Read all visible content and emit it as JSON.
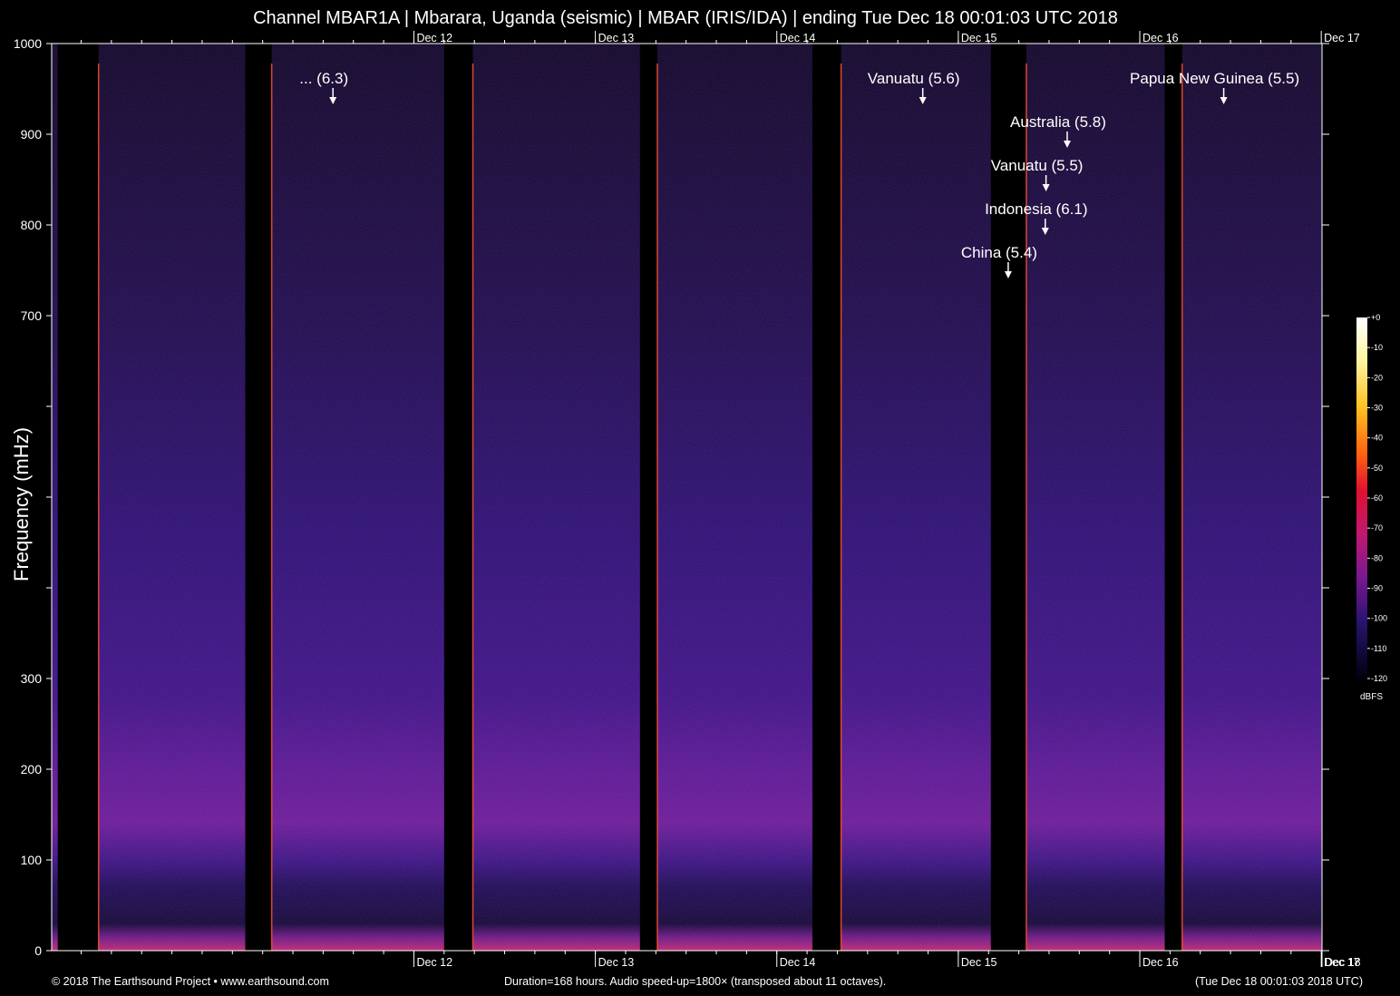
{
  "chart_data": {
    "type": "heatmap",
    "title": "Channel MBAR1A | Mbarara, Uganda (seismic) | MBAR (IRIS/IDA) | ending Tue Dec 18 00:01:03 UTC 2018",
    "ylabel": "Frequency (mHz)",
    "xlabel": "",
    "ylim": [
      0,
      1000
    ],
    "y_ticks": [
      0,
      100,
      200,
      300,
      700,
      800,
      900,
      1000
    ],
    "y_minor_ticks": [
      400,
      500,
      600
    ],
    "x_range_hours": [
      0,
      168
    ],
    "x_ticks": [
      {
        "label": "Dec 12",
        "hour": 47.9
      },
      {
        "label": "Dec 13",
        "hour": 71.9
      },
      {
        "label": "Dec 14",
        "hour": 95.9
      },
      {
        "label": "Dec 15",
        "hour": 119.9
      },
      {
        "label": "Dec 16",
        "hour": 143.9
      },
      {
        "label": "Dec 17",
        "hour": 167.9
      },
      {
        "label": "Dec 18",
        "hour": 168.0
      }
    ],
    "x_ticks_top": [
      "Dec 12",
      "Dec 13",
      "Dec 14",
      "Dec 15",
      "Dec 16",
      "Dec 17"
    ],
    "colorbar": {
      "label": "dBFS",
      "ticks": [
        "+0",
        "-10",
        "-20",
        "-30",
        "-40",
        "-50",
        "-60",
        "-70",
        "-80",
        "-90",
        "-100",
        "-110",
        "-120"
      ],
      "range": [
        -120,
        0
      ]
    },
    "annotations": [
      {
        "label": "... (6.3)",
        "hour": 37.2,
        "level": 0
      },
      {
        "label": "Vanuatu (5.6)",
        "hour": 115.2,
        "level": 0
      },
      {
        "label": "Papua New Guinea (5.5)",
        "hour": 155.0,
        "level": 0
      },
      {
        "label": "Australia (5.8)",
        "hour": 134.3,
        "level": 1
      },
      {
        "label": "Vanuatu (5.5)",
        "hour": 131.5,
        "level": 2
      },
      {
        "label": "Indonesia (6.1)",
        "hour": 131.4,
        "level": 3
      },
      {
        "label": "China (5.4)",
        "hour": 126.5,
        "level": 4
      }
    ],
    "data_gaps_hours": [
      {
        "start": 0.8,
        "end": 6.2
      },
      {
        "start": 25.6,
        "end": 29.1
      },
      {
        "start": 51.9,
        "end": 55.7
      },
      {
        "start": 77.8,
        "end": 80.1
      },
      {
        "start": 100.6,
        "end": 104.4
      },
      {
        "start": 124.2,
        "end": 128.9
      },
      {
        "start": 147.2,
        "end": 149.5
      }
    ],
    "colors": {
      "background": "#000000",
      "noise_floor": "#1a0a3a",
      "band_peak": "#6a1a8a",
      "low_band": "#a0208a",
      "edge_line": "#ff5030"
    }
  },
  "footer": {
    "left": "© 2018 The Earthsound Project • www.earthsound.com",
    "center": "Duration=168 hours. Audio speed-up=1800× (transposed about 11 octaves).",
    "right": "(Tue Dec 18 00:01:03 2018 UTC)"
  }
}
